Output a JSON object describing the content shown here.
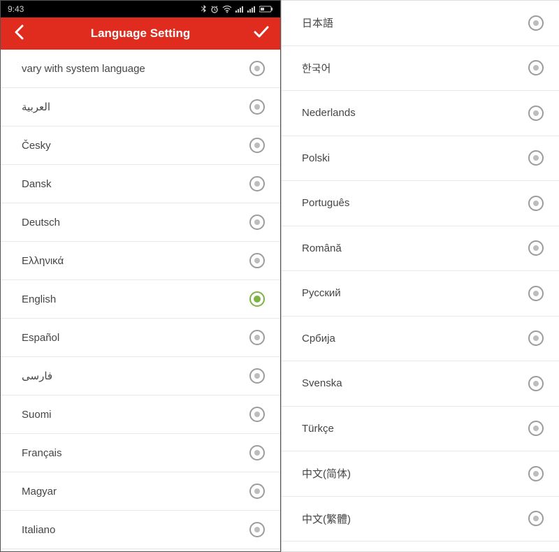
{
  "statusbar": {
    "time": "9:43"
  },
  "header": {
    "title": "Language Setting"
  },
  "left_items": [
    {
      "label": "vary with system language",
      "selected": false,
      "rtl": false
    },
    {
      "label": "العربية",
      "selected": false,
      "rtl": true
    },
    {
      "label": "Česky",
      "selected": false,
      "rtl": false
    },
    {
      "label": "Dansk",
      "selected": false,
      "rtl": false
    },
    {
      "label": "Deutsch",
      "selected": false,
      "rtl": false
    },
    {
      "label": "Ελληνικά",
      "selected": false,
      "rtl": false
    },
    {
      "label": "English",
      "selected": true,
      "rtl": false
    },
    {
      "label": "Español",
      "selected": false,
      "rtl": false
    },
    {
      "label": "فارسی",
      "selected": false,
      "rtl": true
    },
    {
      "label": "Suomi",
      "selected": false,
      "rtl": false
    },
    {
      "label": "Français",
      "selected": false,
      "rtl": false
    },
    {
      "label": "Magyar",
      "selected": false,
      "rtl": false
    },
    {
      "label": "Italiano",
      "selected": false,
      "rtl": false
    }
  ],
  "right_items": [
    {
      "label": "日本語",
      "selected": false
    },
    {
      "label": "한국어",
      "selected": false
    },
    {
      "label": "Nederlands",
      "selected": false
    },
    {
      "label": "Polski",
      "selected": false
    },
    {
      "label": "Português",
      "selected": false
    },
    {
      "label": "Română",
      "selected": false
    },
    {
      "label": "Русский",
      "selected": false
    },
    {
      "label": "Србија",
      "selected": false
    },
    {
      "label": "Svenska",
      "selected": false
    },
    {
      "label": "Türkçe",
      "selected": false
    },
    {
      "label": "中文(简体)",
      "selected": false
    },
    {
      "label": "中文(繁體)",
      "selected": false
    }
  ]
}
